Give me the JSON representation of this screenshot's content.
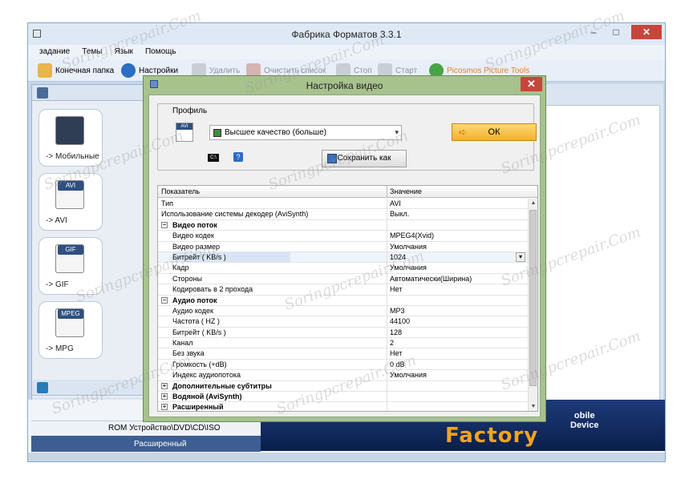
{
  "app": {
    "title": "Фабрика Форматов 3.3.1",
    "controls": {
      "minimize": "–",
      "maximize": "□",
      "close": "✕"
    }
  },
  "menu": [
    "задание",
    "Темы",
    "Язык",
    "Помощь"
  ],
  "toolbar": {
    "output_folder": "Конечная папка",
    "settings": "Настройки",
    "delete": "Удалить",
    "clear_list": "Очистить список",
    "stop": "Стоп",
    "start": "Старт",
    "picosmos": "Picosmos Picture Tools"
  },
  "categories": [
    {
      "label": "-> Мобильные",
      "tag": ""
    },
    {
      "label": "-> AVI",
      "tag": "AVI"
    },
    {
      "label": "-> GIF",
      "tag": "GIF"
    },
    {
      "label": "-> MPG",
      "tag": "MPEG"
    }
  ],
  "bottom": {
    "rom": "ROM Устройство\\DVD\\CD\\ISO",
    "advanced": "Расширенный",
    "brand": "Factory",
    "device": "obile\nDevice"
  },
  "dialog": {
    "title": "Настройка видео",
    "close": "✕",
    "profile_legend": "Профиль",
    "profile_value": "Высшее качество (больше)",
    "ok": "ОК",
    "save_as": "Сохранить как",
    "help": "?",
    "cmd": "C:\\",
    "col_param": "Показатель",
    "col_value": "Значение"
  },
  "grid_rows": [
    {
      "kind": "plain",
      "name": "Тип",
      "value": "AVI"
    },
    {
      "kind": "plain",
      "name": "Использование системы декодер (AviSynth)",
      "value": "Выкл."
    },
    {
      "kind": "group",
      "name": "Видео поток",
      "expander": "−",
      "value": ""
    },
    {
      "kind": "child",
      "name": "Видео кодек",
      "value": "MPEG4(Xvid)"
    },
    {
      "kind": "child",
      "name": "Видео размер",
      "value": "Умолчания"
    },
    {
      "kind": "selected",
      "name": "Битрейт ( KB/s )",
      "value": "1024"
    },
    {
      "kind": "child",
      "name": "Кадр",
      "value": "Умолчания"
    },
    {
      "kind": "child",
      "name": "Стороны",
      "value": "Автоматически(Ширина)"
    },
    {
      "kind": "child",
      "name": "Кодировать в 2 прохода",
      "value": "Нет"
    },
    {
      "kind": "group",
      "name": "Аудио поток",
      "expander": "−",
      "value": ""
    },
    {
      "kind": "child",
      "name": "Аудио кодек",
      "value": "MP3"
    },
    {
      "kind": "child",
      "name": "Частота ( HZ )",
      "value": "44100"
    },
    {
      "kind": "child",
      "name": "Битрейт ( KB/s )",
      "value": "128"
    },
    {
      "kind": "child",
      "name": "Канал",
      "value": "2"
    },
    {
      "kind": "child",
      "name": "Без звука",
      "value": "Нет"
    },
    {
      "kind": "child",
      "name": "Громкость (+dB)",
      "value": "0 dB"
    },
    {
      "kind": "child",
      "name": "Индекс аудиопотока",
      "value": "Умолчания"
    },
    {
      "kind": "group",
      "name": "Дополнительные субтитры",
      "expander": "+",
      "value": ""
    },
    {
      "kind": "group",
      "name": "Водяной (AviSynth)",
      "expander": "+",
      "value": ""
    },
    {
      "kind": "group",
      "name": "Расширенный",
      "expander": "+",
      "value": ""
    }
  ],
  "watermark": "Soringpcrepair.Com",
  "colors": {
    "accent": "#f4a41f",
    "dialog_frame": "#a7c28d",
    "close": "#c7463b"
  }
}
